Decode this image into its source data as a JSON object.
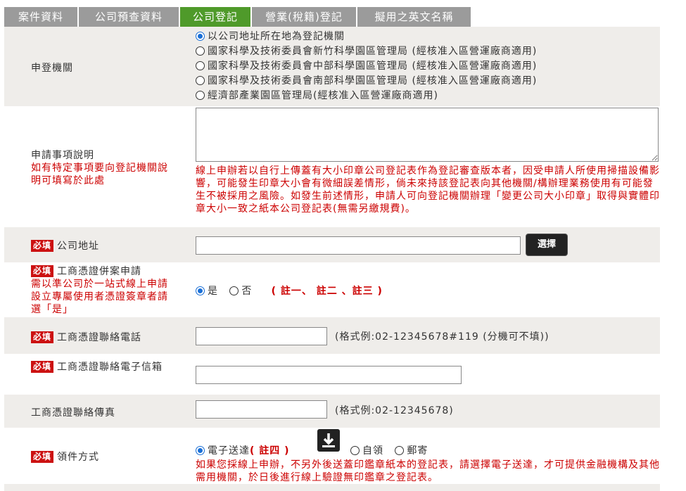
{
  "tabs": [
    "案件資料",
    "公司預查資料",
    "公司登記",
    "營業(稅籍)登記",
    "擬用之英文名稱"
  ],
  "required_tag": "必填",
  "registration_office": {
    "label": "申登機關",
    "options": [
      "以公司地址所在地為登記機關",
      "國家科學及技術委員會新竹科學園區管理局 (經核准入區營運廠商適用)",
      "國家科學及技術委員會中部科學園區管理局 (經核准入區營運廠商適用)",
      "國家科學及技術委員會南部科學園區管理局 (經核准入區營運廠商適用)",
      "經濟部產業園區管理局(經核准入區營運廠商適用)"
    ],
    "selected_index": 0
  },
  "application_note": {
    "label": "申請事項說明",
    "label_red": "如有特定事項要向登記機關說明可填寫於此處",
    "textarea_value": "",
    "warning": "線上申辦若以自行上傳蓋有大小印章公司登記表作為登記審查版本者，因受申請人所使用掃描設備影響，可能發生印章大小會有微細誤差情形，倘未來持該登記表向其他機關/構辦理業務使用有可能發生不被採用之風險。如發生前述情形，申請人可向登記機關辦理「變更公司大小印章」取得與實體印章大小一致之紙本公司登記表(無需另繳規費)。"
  },
  "company_address": {
    "label": "公司地址",
    "value": "",
    "select_button": "選擇"
  },
  "moea_certificate": {
    "label": "工商憑證併案申請",
    "label_red": "需以準公司於一站式線上申請設立專屬使用者憑證簽章者請選「是」",
    "yes": "是",
    "no": "否",
    "selected": "yes",
    "notes": "( 註一、 註二 、註三 )"
  },
  "cert_phone": {
    "label": "工商憑證聯絡電話",
    "value": "",
    "hint": "(格式例:02-12345678#119 (分機可不填))"
  },
  "cert_email": {
    "label": "工商憑證聯絡電子信箱",
    "value": ""
  },
  "cert_fax": {
    "label": "工商憑證聯絡傳真",
    "value": "",
    "hint": "(格式例:02-12345678)"
  },
  "pickup_method": {
    "label": "領件方式",
    "options": [
      "電子送達",
      "自領",
      "郵寄"
    ],
    "note_tag": "( 註四 )",
    "selected_index": 0,
    "warning": "如果您採線上申辦，不另外後送蓋印鑑章紙本的登記表，請選擇電子送達，才可提供金融機構及其他需用機關，於日後進行線上驗證無印鑑章之登記表。"
  }
}
